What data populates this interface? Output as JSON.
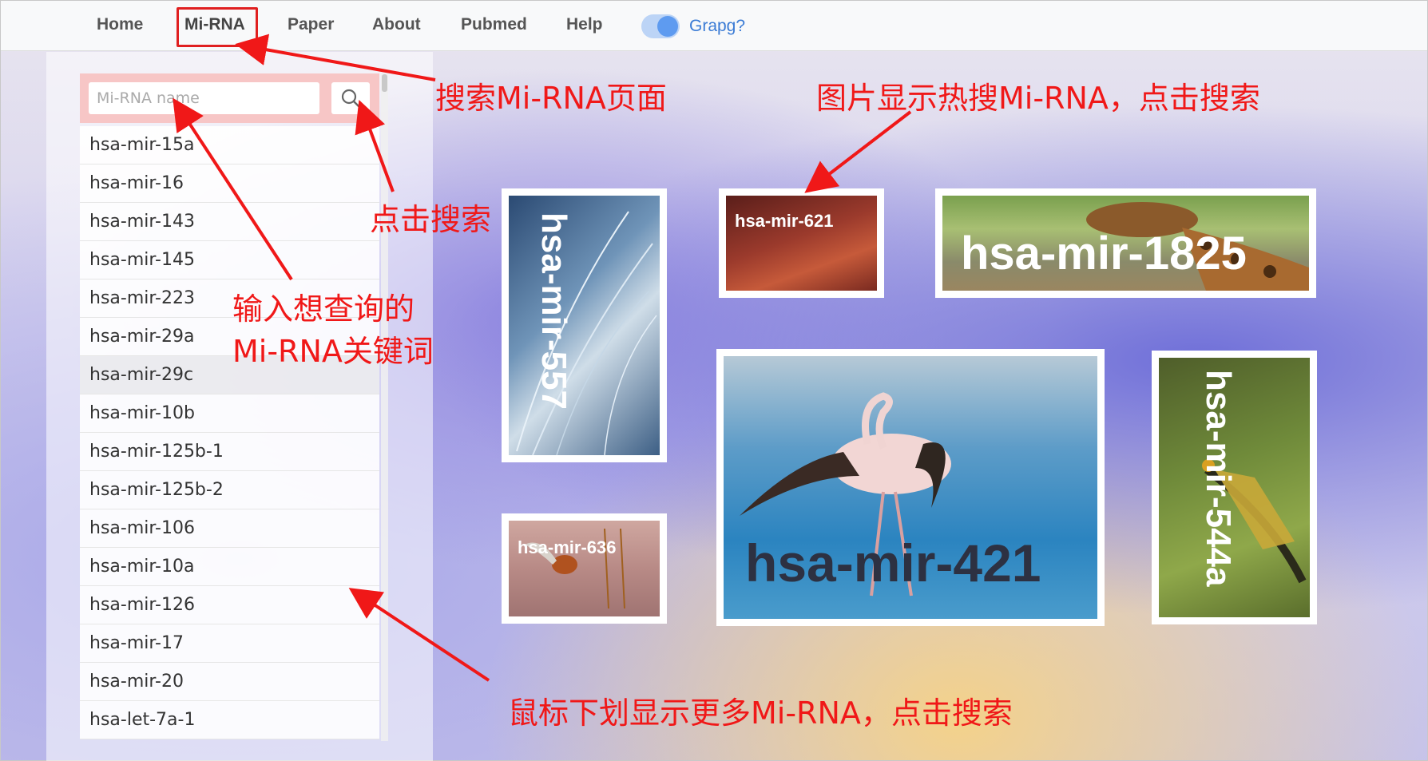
{
  "nav": {
    "items": [
      "Home",
      "Mi-RNA",
      "Paper",
      "About",
      "Pubmed",
      "Help"
    ],
    "toggle_label": "Grapg?"
  },
  "search": {
    "placeholder": "Mi-RNA name"
  },
  "mirna_list": [
    "hsa-mir-15a",
    "hsa-mir-16",
    "hsa-mir-143",
    "hsa-mir-145",
    "hsa-mir-223",
    "hsa-mir-29a",
    "hsa-mir-29c",
    "hsa-mir-10b",
    "hsa-mir-125b-1",
    "hsa-mir-125b-2",
    "hsa-mir-106",
    "hsa-mir-10a",
    "hsa-mir-126",
    "hsa-mir-17",
    "hsa-mir-20",
    "hsa-let-7a-1"
  ],
  "tiles": {
    "t557": "hsa-mir-557",
    "t621": "hsa-mir-621",
    "t1825": "hsa-mir-1825",
    "t421": "hsa-mir-421",
    "t544a": "hsa-mir-544a",
    "t636": "hsa-mir-636"
  },
  "annotations": {
    "search_page": "搜索Mi-RNA页面",
    "image_hot": "图片显示热搜Mi-RNA，点击搜索",
    "click_search": "点击搜索",
    "input_hint_1": "输入想查询的",
    "input_hint_2": "Mi-RNA关键词",
    "scroll_hint": "鼠标下划显示更多Mi-RNA，点击搜索"
  },
  "colors": {
    "annotation_red": "#f01818",
    "toggle_blue": "#5e9bf0"
  }
}
